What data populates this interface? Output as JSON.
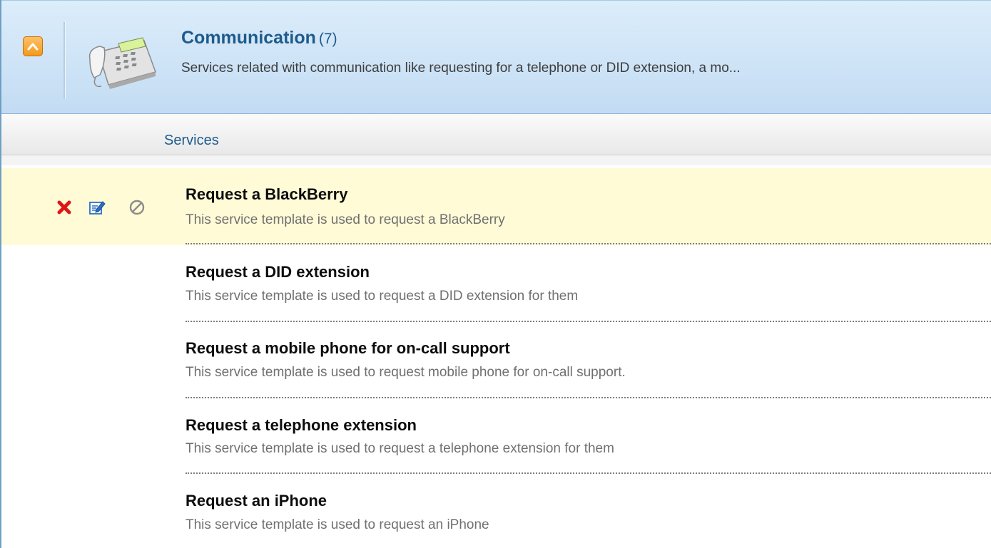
{
  "category": {
    "title": "Communication",
    "count": "(7)",
    "description": "Services related with communication like requesting for a telephone or DID extension, a mo...",
    "icon": "telephone-icon",
    "collapse_icon": "chevron-up-icon"
  },
  "section": {
    "label": "Services"
  },
  "row_actions": {
    "delete_icon": "delete-icon",
    "edit_icon": "edit-icon",
    "disable_icon": "disable-icon"
  },
  "services": [
    {
      "title": "Request a BlackBerry",
      "description": "This service template is used to request a BlackBerry",
      "highlighted": true
    },
    {
      "title": "Request a DID extension",
      "description": "This service template is used to request a DID extension for them"
    },
    {
      "title": "Request a mobile phone for on-call support",
      "description": "This service template is used to request mobile phone for on-call support."
    },
    {
      "title": "Request a telephone extension",
      "description": "This service template is used to request a telephone extension for them"
    },
    {
      "title": "Request an iPhone",
      "description": "This service template is used to request an iPhone"
    }
  ],
  "colors": {
    "accent": "#1e5b8c",
    "highlight_row": "#fffbd7",
    "header_bg": "#c9e0f5",
    "collapse_button": "#f39a1b"
  }
}
